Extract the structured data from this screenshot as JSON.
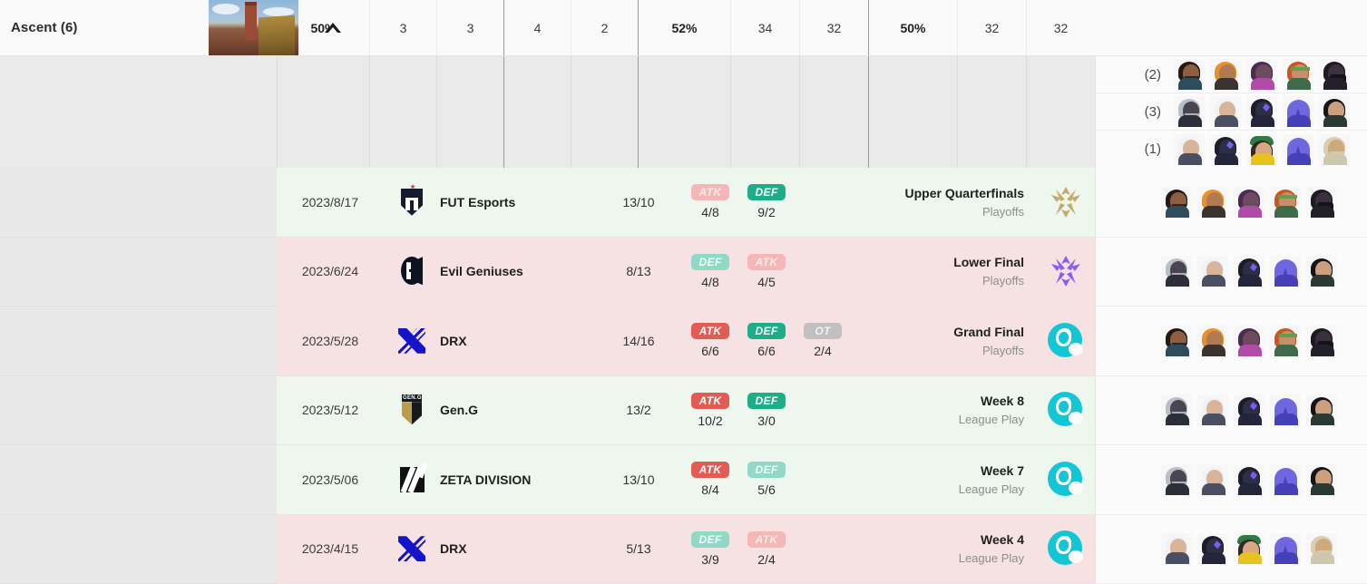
{
  "map": {
    "title": "Ascent (6)",
    "thumbnail_alt": "ascent-map-thumbnail",
    "collapse_icon": "chevron-up-icon"
  },
  "header_stats": [
    {
      "value": "50%",
      "bold": true,
      "group_start": false
    },
    {
      "value": "3",
      "bold": false,
      "group_start": false
    },
    {
      "value": "3",
      "bold": false,
      "group_start": false
    },
    {
      "value": "4",
      "bold": false,
      "group_start": true
    },
    {
      "value": "2",
      "bold": false,
      "group_start": false
    },
    {
      "value": "52%",
      "bold": true,
      "group_start": true
    },
    {
      "value": "34",
      "bold": false,
      "group_start": false
    },
    {
      "value": "32",
      "bold": false,
      "group_start": false
    },
    {
      "value": "50%",
      "bold": true,
      "group_start": true
    },
    {
      "value": "32",
      "bold": false,
      "group_start": false
    },
    {
      "value": "32",
      "bold": false,
      "group_start": false
    }
  ],
  "compositions": [
    {
      "count": "(2)",
      "agents": [
        "brimstone",
        "skye",
        "fade",
        "sage",
        "viper"
      ]
    },
    {
      "count": "(3)",
      "agents": [
        "omen",
        "jett",
        "kayo",
        "omen-alt",
        "reyna"
      ]
    },
    {
      "count": "(1)",
      "agents": [
        "jett",
        "kayo",
        "killjoy",
        "omen-alt",
        "breach"
      ]
    }
  ],
  "matches": [
    {
      "result": "win",
      "date": "2023/8/17",
      "team": "FUT Esports",
      "team_logo": "fut-esports-logo",
      "score": "13/10",
      "sides": [
        {
          "label": "ATK",
          "value": "4/8",
          "style": "atk-l"
        },
        {
          "label": "DEF",
          "value": "9/2",
          "style": "def-w"
        }
      ],
      "event": "Upper Quarterfinals",
      "stage": "Playoffs",
      "event_icon": "vct-gold-icon",
      "agents": [
        "brimstone",
        "skye",
        "fade",
        "sage",
        "viper"
      ]
    },
    {
      "result": "loss",
      "date": "2023/6/24",
      "team": "Evil Geniuses",
      "team_logo": "evil-geniuses-logo",
      "score": "8/13",
      "sides": [
        {
          "label": "DEF",
          "value": "4/8",
          "style": "def-l"
        },
        {
          "label": "ATK",
          "value": "4/5",
          "style": "atk-l"
        }
      ],
      "event": "Lower Final",
      "stage": "Playoffs",
      "event_icon": "vct-purple-icon",
      "agents": [
        "omen",
        "jett",
        "kayo",
        "omen-alt",
        "reyna"
      ]
    },
    {
      "result": "loss",
      "date": "2023/5/28",
      "team": "DRX",
      "team_logo": "drx-logo",
      "score": "14/16",
      "sides": [
        {
          "label": "ATK",
          "value": "6/6",
          "style": "atk-w"
        },
        {
          "label": "DEF",
          "value": "6/6",
          "style": "def-w"
        },
        {
          "label": "OT",
          "value": "2/4",
          "style": "ot"
        }
      ],
      "event": "Grand Final",
      "stage": "Playoffs",
      "event_icon": "pacific-wave-icon",
      "agents": [
        "brimstone",
        "skye",
        "fade",
        "sage",
        "viper"
      ]
    },
    {
      "result": "win",
      "date": "2023/5/12",
      "team": "Gen.G",
      "team_logo": "geng-logo",
      "score": "13/2",
      "sides": [
        {
          "label": "ATK",
          "value": "10/2",
          "style": "atk-w"
        },
        {
          "label": "DEF",
          "value": "3/0",
          "style": "def-w"
        }
      ],
      "event": "Week 8",
      "stage": "League Play",
      "event_icon": "pacific-wave-icon",
      "agents": [
        "omen",
        "jett",
        "kayo",
        "omen-alt",
        "reyna"
      ]
    },
    {
      "result": "win",
      "date": "2023/5/06",
      "team": "ZETA DIVISION",
      "team_logo": "zeta-division-logo",
      "score": "13/10",
      "sides": [
        {
          "label": "ATK",
          "value": "8/4",
          "style": "atk-w"
        },
        {
          "label": "DEF",
          "value": "5/6",
          "style": "def-l"
        }
      ],
      "event": "Week 7",
      "stage": "League Play",
      "event_icon": "pacific-wave-icon",
      "agents": [
        "omen",
        "jett",
        "kayo",
        "omen-alt",
        "reyna"
      ]
    },
    {
      "result": "loss",
      "date": "2023/4/15",
      "team": "DRX",
      "team_logo": "drx-logo",
      "score": "5/13",
      "sides": [
        {
          "label": "DEF",
          "value": "3/9",
          "style": "def-l"
        },
        {
          "label": "ATK",
          "value": "2/4",
          "style": "atk-l"
        }
      ],
      "event": "Week 4",
      "stage": "League Play",
      "event_icon": "pacific-wave-icon",
      "agents": [
        "jett",
        "kayo",
        "killjoy",
        "omen-alt",
        "breach"
      ]
    }
  ],
  "colors": {
    "win_row": "#edf7ee",
    "loss_row": "#f6e2e2",
    "atk_win": "#e35c54",
    "def_win": "#1eae87",
    "atk_loss": "#f5b6b6",
    "def_loss": "#8fd9c6",
    "overtime": "#c0c0c0",
    "frozen_bg": "#e8e8e8"
  }
}
